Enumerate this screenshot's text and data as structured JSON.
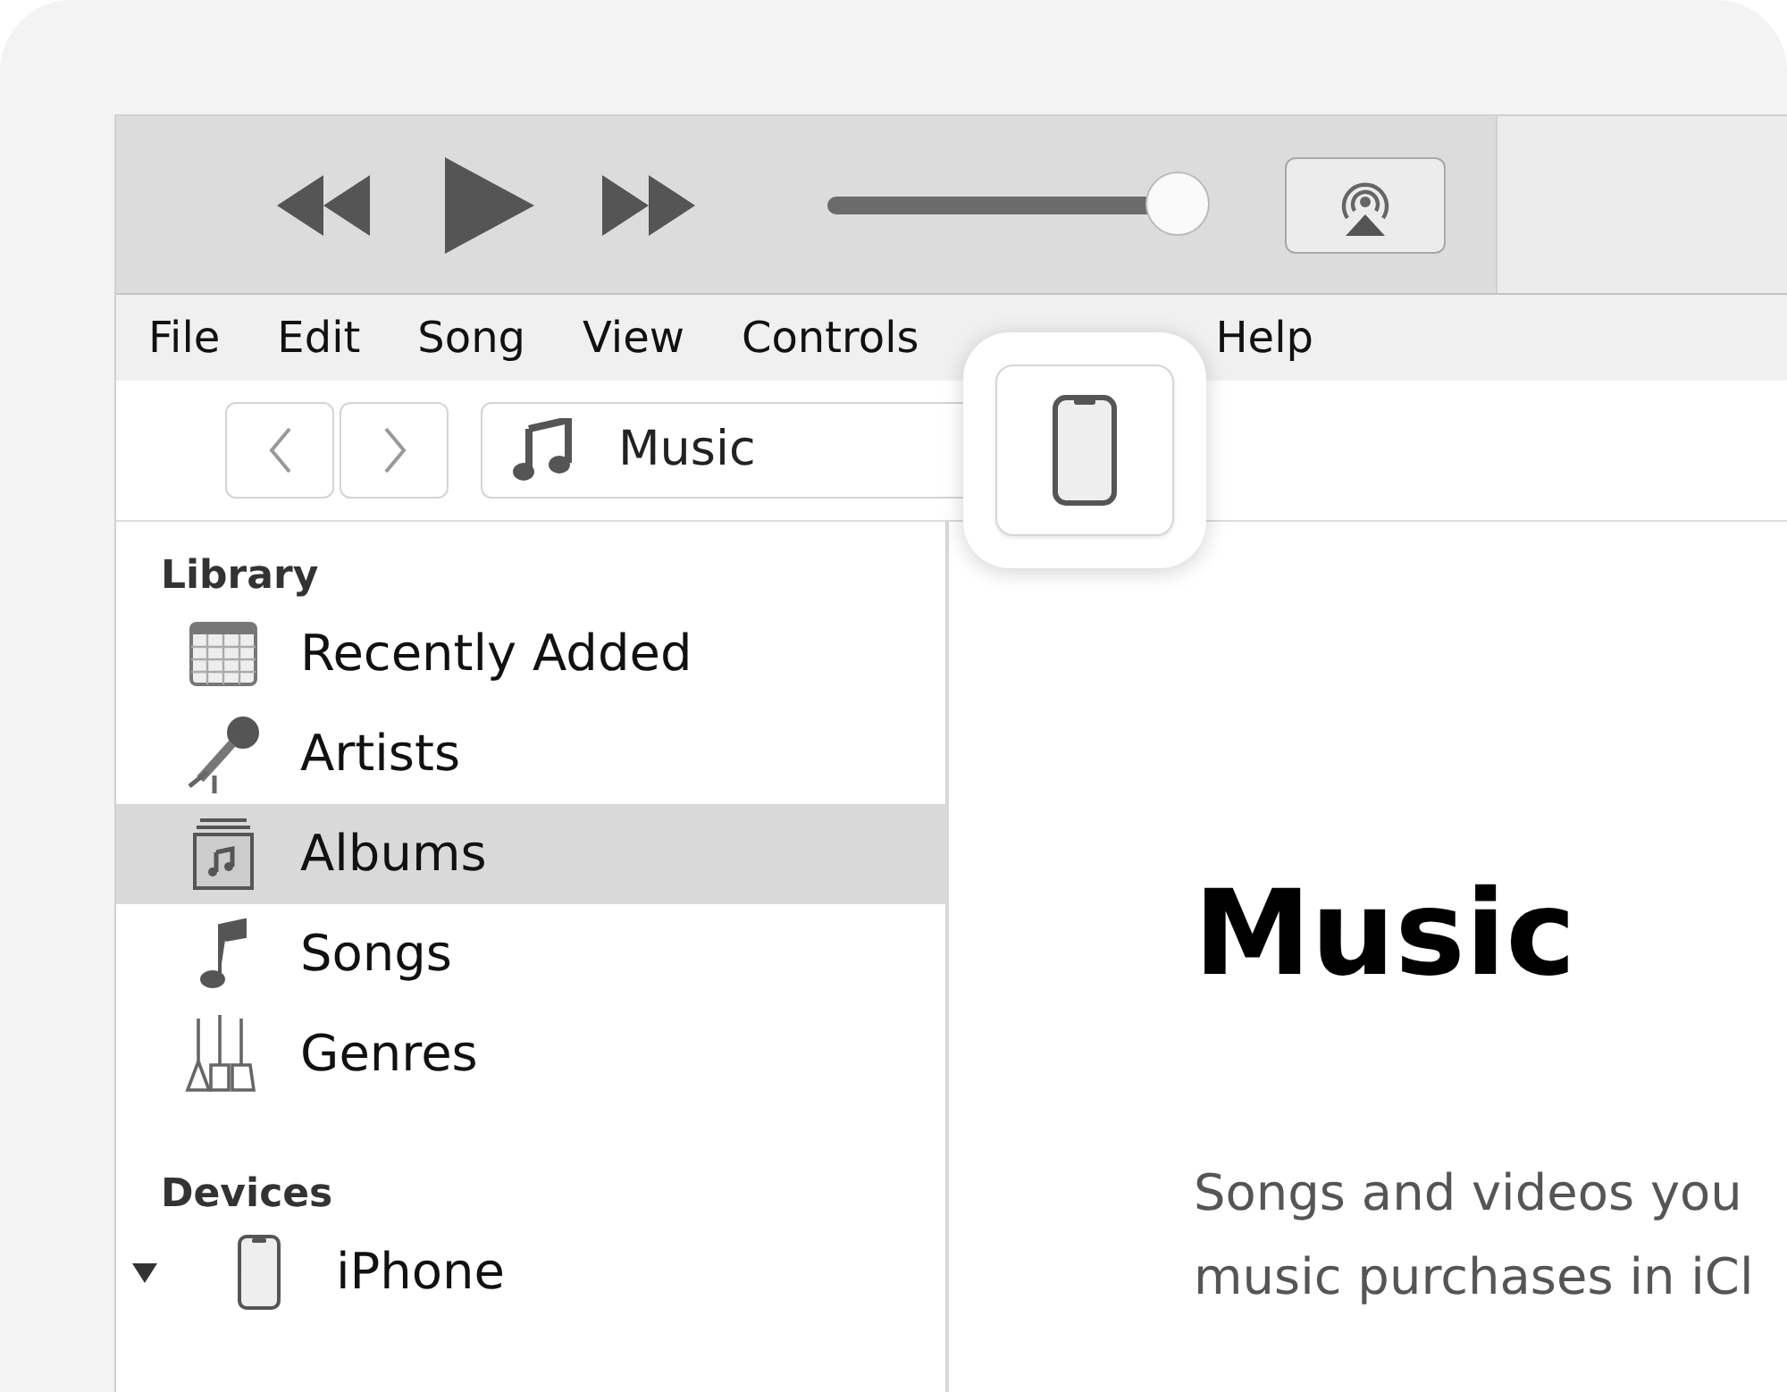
{
  "player": {
    "volume": {
      "level": 0.98
    }
  },
  "menu_bar": [
    "File",
    "Edit",
    "Song",
    "View",
    "Controls",
    "Help"
  ],
  "nav": {
    "media_picker": "Music"
  },
  "sidebar": {
    "sections": [
      {
        "title": "Library",
        "items": [
          {
            "label": "Recently Added",
            "kind": "recent",
            "selected": false
          },
          {
            "label": "Artists",
            "kind": "artists",
            "selected": false
          },
          {
            "label": "Albums",
            "kind": "albums",
            "selected": true
          },
          {
            "label": "Songs",
            "kind": "songs",
            "selected": false
          },
          {
            "label": "Genres",
            "kind": "genres",
            "selected": false
          }
        ]
      },
      {
        "title": "Devices",
        "items": [
          {
            "label": "iPhone",
            "kind": "phone",
            "selected": false,
            "expanded": true
          }
        ]
      }
    ]
  },
  "main": {
    "title": "Music",
    "lines": [
      "Songs and videos you",
      "music purchases in iCl"
    ]
  }
}
